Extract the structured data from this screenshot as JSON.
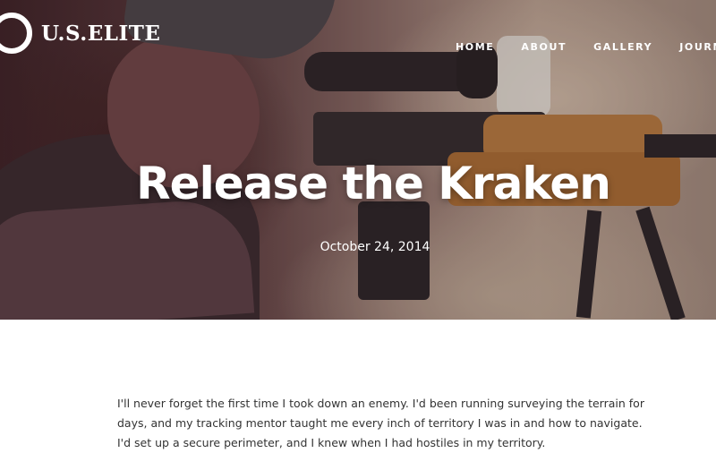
{
  "brand": {
    "logo_text": "U.S.ELITE"
  },
  "nav": {
    "items": [
      {
        "label": "HOME"
      },
      {
        "label": "ABOUT"
      },
      {
        "label": "GALLERY"
      },
      {
        "label": "JOURNAL"
      }
    ]
  },
  "post": {
    "title": "Release the Kraken",
    "date": "October 24, 2014",
    "body": "I'll never forget the first time I took down an enemy. I'd been running surveying the terrain for days, and my tracking mentor taught me every inch of territory I was in and how to navigate. I'd set up a secure perimeter, and I knew when I had hostiles in my territory."
  },
  "colors": {
    "text_light": "#ffffff",
    "body_text": "#333333",
    "stock_wood": "#b5793f"
  }
}
